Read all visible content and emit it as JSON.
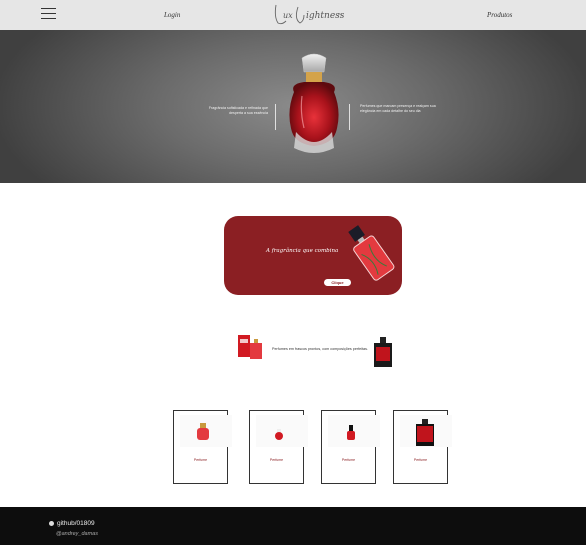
{
  "header": {
    "login_label": "Login",
    "produtos_label": "Produtos",
    "logo_text": "Lux Lightness"
  },
  "hero": {
    "left_text": "Fragrância sofisticada e refinada que desperta a sua essência",
    "right_text": "Perfumes que marcam presença e realçam sua elegância em cada detalhe do seu dia"
  },
  "promo": {
    "tagline": "A fragrância que combina",
    "button_label": "Clique"
  },
  "info": {
    "text": "Perfumes em frascos prontos, com composições perfeitas."
  },
  "products": [
    {
      "label": "Perfume"
    },
    {
      "label": "Perfume"
    },
    {
      "label": "Perfume"
    },
    {
      "label": "Perfume"
    }
  ],
  "footer": {
    "github": "github/01809",
    "handle": "@andrey_damas"
  },
  "colors": {
    "accent": "#8b1f23",
    "header_bg": "#e6e6e6",
    "footer_bg": "#0d0d0d"
  }
}
